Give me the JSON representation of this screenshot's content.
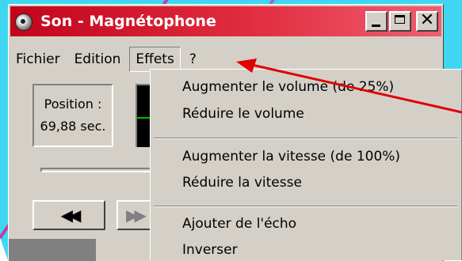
{
  "window": {
    "title": "Son - Magnétophone",
    "controls": {
      "minimize": "_",
      "maximize": "□",
      "close": "✕"
    }
  },
  "menubar": {
    "items": [
      "Fichier",
      "Edition",
      "Effets",
      "?"
    ],
    "active_index": 2
  },
  "status": {
    "position_label": "Position :",
    "position_value": "69,88 sec."
  },
  "transport": {
    "rewind": "◀◀",
    "forward": "▶▶"
  },
  "effets_menu": {
    "items": [
      "Augmenter le volume (de 25%)",
      "Réduire le volume",
      "Augmenter la vitesse (de 100%)",
      "Réduire la vitesse",
      "Ajouter de l'écho",
      "Inverser"
    ]
  },
  "colors": {
    "titlebar": "#c2041b",
    "annotation_arrow": "#e00000",
    "background_cyan": "#3fd6f2",
    "background_stripe": "#c43aa6",
    "wave": "#00c000"
  },
  "icons": {
    "app": "sound-recorder-icon",
    "minimize": "minimize-icon",
    "maximize": "maximize-icon",
    "close": "close-icon"
  }
}
